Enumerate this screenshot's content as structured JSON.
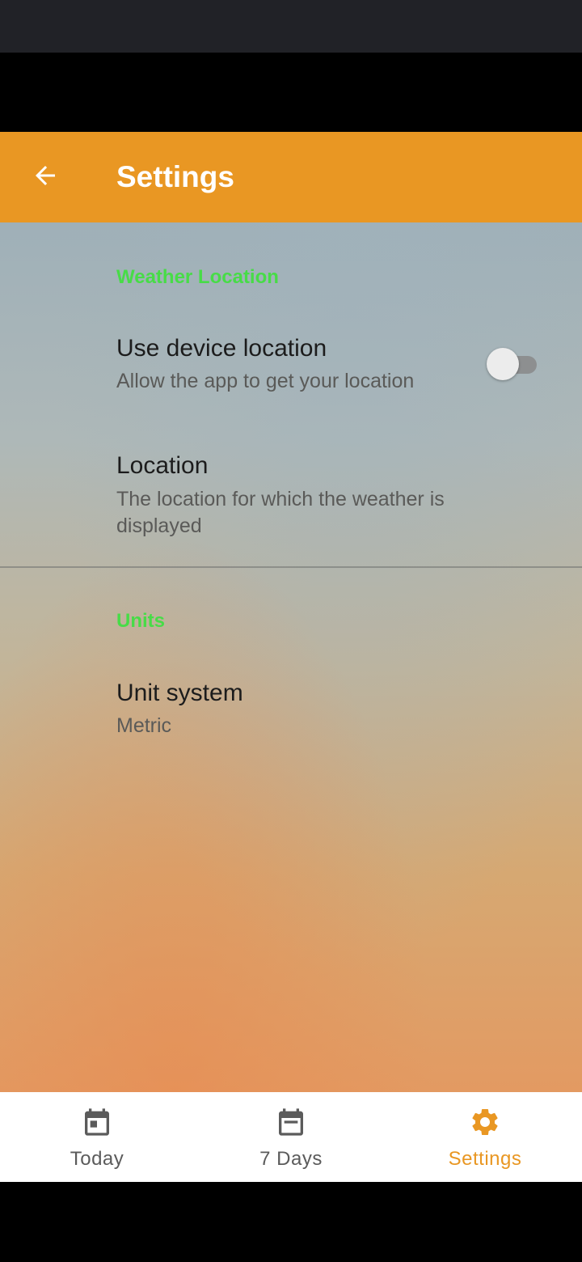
{
  "app_bar": {
    "title": "Settings",
    "back_icon": "arrow-left-icon",
    "background": "#e99723"
  },
  "sections": {
    "weather_location": {
      "header": "Weather Location",
      "use_device_location": {
        "title": "Use device location",
        "summary": "Allow the app to get your location",
        "enabled": false
      },
      "location": {
        "title": "Location",
        "summary": "The location for which the weather is displayed"
      }
    },
    "units": {
      "header": "Units",
      "unit_system": {
        "title": "Unit system",
        "summary": "Metric"
      }
    }
  },
  "bottom_nav": {
    "items": [
      {
        "label": "Today",
        "icon": "calendar-today-icon",
        "active": false
      },
      {
        "label": "7 Days",
        "icon": "calendar-week-icon",
        "active": false
      },
      {
        "label": "Settings",
        "icon": "gear-icon",
        "active": true
      }
    ]
  },
  "colors": {
    "accent": "#e99723",
    "section_header": "#47dc47",
    "nav_inactive": "#5b5b5b"
  }
}
